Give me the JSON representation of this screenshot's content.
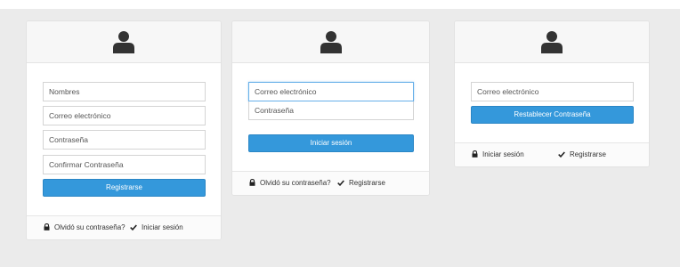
{
  "register_card": {
    "fields": [
      {
        "placeholder": "Nombres"
      },
      {
        "placeholder": "Correo electrónico"
      },
      {
        "placeholder": "Contraseña"
      },
      {
        "placeholder": "Confirmar Contraseña"
      }
    ],
    "submit_label": "Registrarse",
    "footer": {
      "forgot_label": "Olvidó su contraseña?",
      "login_label": "Iniciar sesión"
    }
  },
  "login_card": {
    "fields": [
      {
        "placeholder": "Correo electrónico"
      },
      {
        "placeholder": "Contraseña"
      }
    ],
    "submit_label": "Iniciar sesión",
    "footer": {
      "forgot_label": "Olvidó su contraseña?",
      "register_label": "Registrarse"
    }
  },
  "reset_card": {
    "fields": [
      {
        "placeholder": "Correo electrónico"
      }
    ],
    "submit_label": "Restablecer Contraseña",
    "footer": {
      "login_label": "Iniciar sesión",
      "register_label": "Registrarse"
    }
  },
  "icons": {
    "avatar": "user-icon",
    "forgot": "lock-icon",
    "link": "check-icon"
  },
  "colors": {
    "primary": "#3498db",
    "page_background": "#ebebeb",
    "focus_border": "#66afe9"
  }
}
